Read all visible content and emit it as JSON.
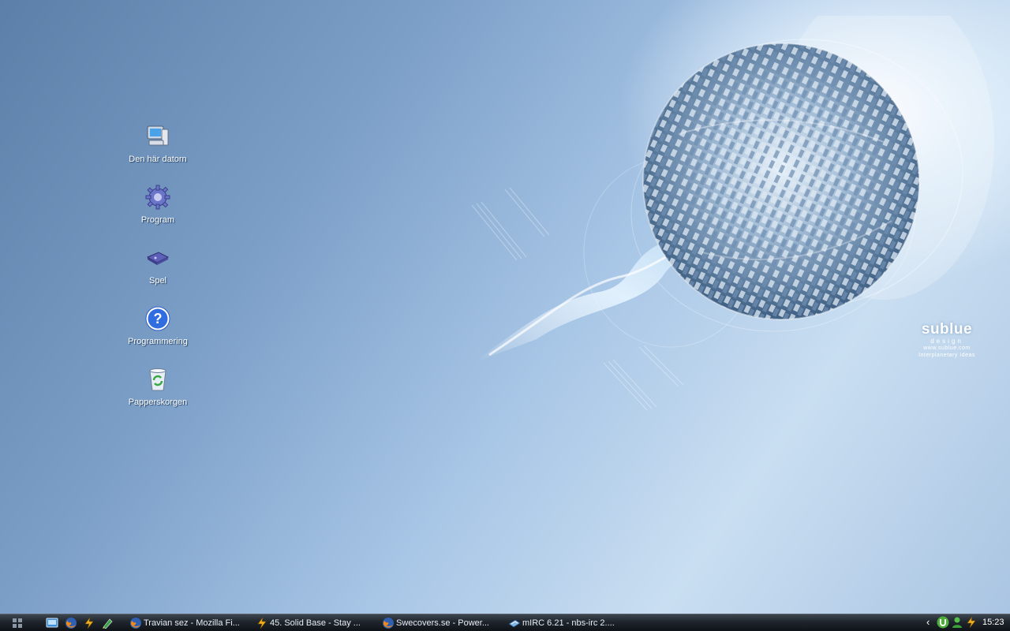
{
  "desktop": {
    "icons": [
      {
        "label": "Den här datorn",
        "icon": "my-computer-icon"
      },
      {
        "label": "Program",
        "icon": "gear-icon"
      },
      {
        "label": "Spel",
        "icon": "gamepad-icon"
      },
      {
        "label": "Programmering",
        "icon": "help-question-icon"
      },
      {
        "label": "Papperskorgen",
        "icon": "recycle-bin-icon"
      }
    ],
    "wallpaper": {
      "brand": "sublue",
      "brand_sub": "design",
      "url": "www.sublue.com",
      "tagline": "Interplanetary Ideas"
    }
  },
  "taskbar": {
    "quick_launch": [
      "show-desktop-icon",
      "firefox-icon",
      "winamp-icon",
      "pen-icon"
    ],
    "tasks": [
      {
        "label": "Travian sez - Mozilla Fi...",
        "icon": "firefox-icon"
      },
      {
        "label": "45. Solid Base - Stay ...",
        "icon": "winamp-icon"
      },
      {
        "label": "Swecovers.se - Power...",
        "icon": "firefox-icon"
      },
      {
        "label": "mIRC 6.21 - nbs-irc 2....",
        "icon": "mirc-icon"
      }
    ],
    "tray": {
      "expand": "‹",
      "icons": [
        "utorrent-icon",
        "messenger-icon",
        "winamp-tray-icon"
      ],
      "clock": "15:23"
    }
  },
  "colors": {
    "taskbar": "#1f252c",
    "desktop_accent": "#7c9fc8"
  }
}
